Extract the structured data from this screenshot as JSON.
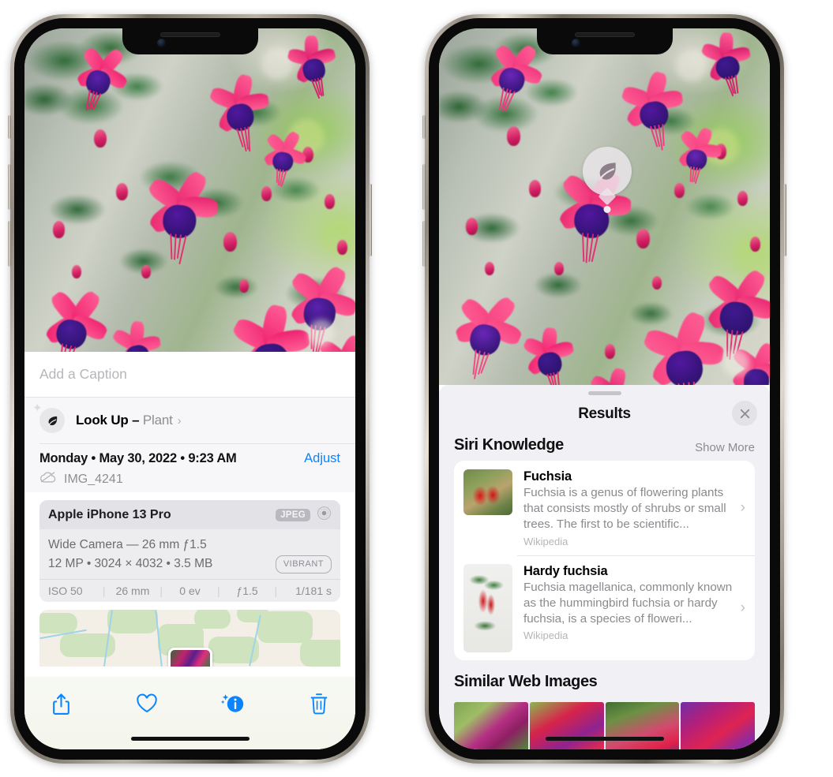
{
  "left_phone": {
    "name": "photos-detail-view",
    "caption_placeholder": "Add a Caption",
    "lookup": {
      "label": "Look Up –",
      "subject": "Plant",
      "icon": "leaf-icon",
      "chevron": "›"
    },
    "meta": {
      "date": "Monday • May 30, 2022 • 9:23 AM",
      "adjust_label": "Adjust",
      "filename": "IMG_4241",
      "cloud_icon": "cloud-slash-icon"
    },
    "exif": {
      "model": "Apple iPhone 13 Pro",
      "format_badge": "JPEG",
      "aperture_icon": "aperture-icon",
      "lens_line": "Wide Camera — 26 mm ƒ1.5",
      "specs_line": "12 MP • 3024 × 4032 • 3.5 MB",
      "style_badge": "VIBRANT",
      "stats": [
        "ISO 50",
        "26 mm",
        "0 ev",
        "ƒ1.5",
        "1/181 s"
      ]
    },
    "toolbar": [
      {
        "name": "share-button",
        "icon": "share-icon"
      },
      {
        "name": "favorite-button",
        "icon": "heart-icon"
      },
      {
        "name": "info-button",
        "icon": "info-sparkle-icon"
      },
      {
        "name": "delete-button",
        "icon": "trash-icon"
      }
    ]
  },
  "right_phone": {
    "name": "visual-lookup-results",
    "badge": {
      "icon": "leaf-icon",
      "label": "plant-detected-badge"
    },
    "sheet": {
      "title": "Results",
      "close_icon": "close-icon",
      "grabber": "drag-handle"
    },
    "siri_knowledge": {
      "title": "Siri Knowledge",
      "show_more": "Show More",
      "items": [
        {
          "title": "Fuchsia",
          "description": "Fuchsia is a genus of flowering plants that consists mostly of shrubs or small trees. The first to be scientific...",
          "source": "Wikipedia",
          "chevron": "›",
          "thumb": "fuchsia-red-flowers-thumbnail"
        },
        {
          "title": "Hardy fuchsia",
          "description": "Fuchsia magellanica, commonly known as the hummingbird fuchsia or hardy fuchsia, is a species of floweri...",
          "source": "Wikipedia",
          "chevron": "›",
          "thumb": "hardy-fuchsia-branch-thumbnail"
        }
      ]
    },
    "similar_web_images": {
      "title": "Similar Web Images",
      "items": [
        "fuchsia-pink-purple-bloom",
        "red-fuchsia-closeup",
        "fuchsia-bush-with-buds",
        "purple-magenta-fuchsia-cluster"
      ]
    }
  },
  "colors": {
    "accent_blue": "#0a84ff",
    "sheet_gray": "#f1f1f5",
    "secondary_text": "#8e8e93"
  }
}
